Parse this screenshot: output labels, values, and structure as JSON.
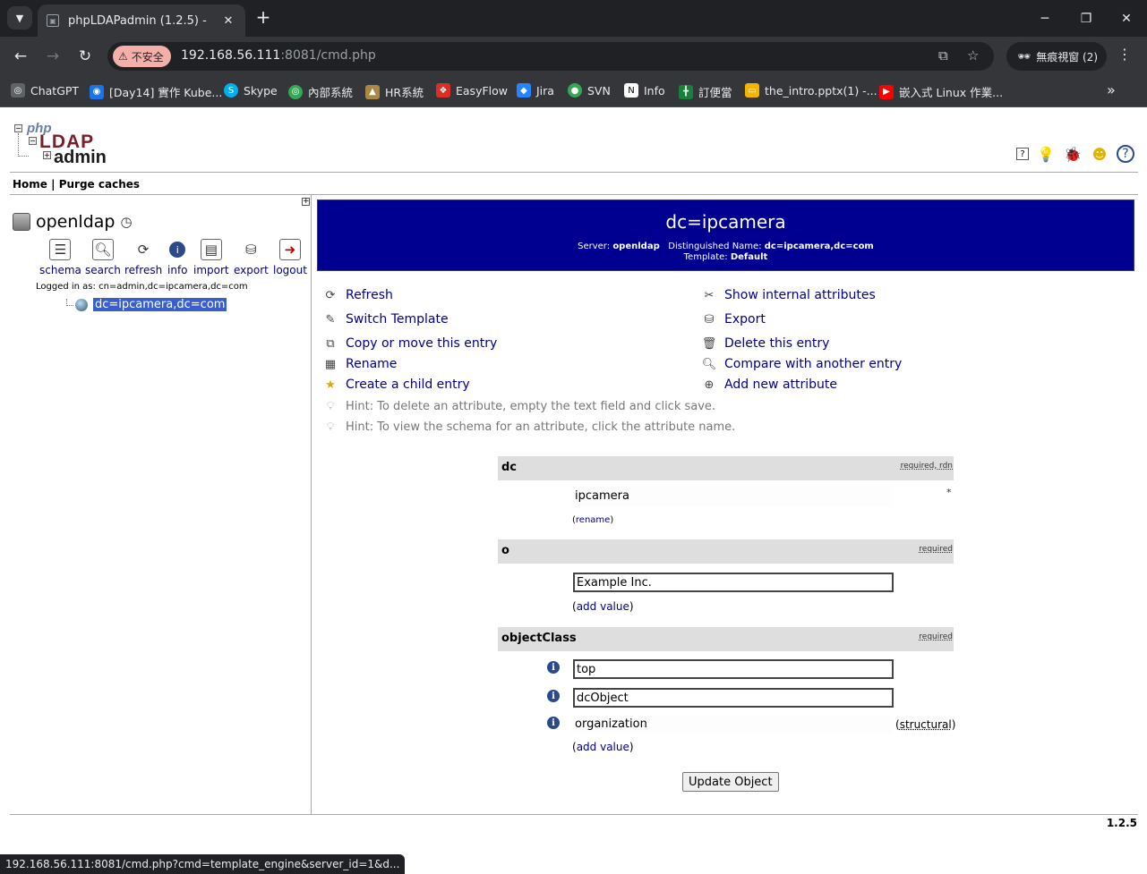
{
  "browser": {
    "tab_title": "phpLDAPadmin (1.2.5) -",
    "insecure_label": "不安全",
    "url_host": "192.168.56.111",
    "url_rest": ":8081/cmd.php",
    "incognito_label": "無痕視窗 (2)",
    "bookmarks": [
      {
        "label": "ChatGPT",
        "icon": "chatgpt-icon",
        "color": "#5f6368"
      },
      {
        "label": "[Day14] 實作 Kube...",
        "icon": "ithome-icon",
        "color": "#1a73e8"
      },
      {
        "label": "Skype",
        "icon": "skype-icon",
        "color": "#00aff0"
      },
      {
        "label": "內部系統",
        "icon": "internal-icon",
        "color": "#34a853"
      },
      {
        "label": "HR系統",
        "icon": "hr-icon",
        "color": "#aa8844"
      },
      {
        "label": "EasyFlow",
        "icon": "easyflow-icon",
        "color": "#d93025"
      },
      {
        "label": "Jira",
        "icon": "jira-icon",
        "color": "#2684ff"
      },
      {
        "label": "SVN",
        "icon": "svn-icon",
        "color": "#34a853"
      },
      {
        "label": "Info",
        "icon": "notion-icon",
        "color": "#ffffff"
      },
      {
        "label": "訂便當",
        "icon": "sheets-icon",
        "color": "#188038"
      },
      {
        "label": "the_intro.pptx(1) -...",
        "icon": "slides-icon",
        "color": "#f4b400"
      },
      {
        "label": "嵌入式 Linux 作業...",
        "icon": "youtube-icon",
        "color": "#ff0000"
      }
    ],
    "status_url": "192.168.56.111:8081/cmd.php?cmd=template_engine&server_id=1&d..."
  },
  "menu": {
    "home": "Home",
    "separator": "|",
    "purge": "Purge caches"
  },
  "server": {
    "name": "openldap",
    "tools": [
      {
        "label": "schema",
        "icon": "schema-icon"
      },
      {
        "label": "search",
        "icon": "search-icon"
      },
      {
        "label": "refresh",
        "icon": "refresh-icon"
      },
      {
        "label": "info",
        "icon": "info-icon"
      },
      {
        "label": "import",
        "icon": "import-icon"
      },
      {
        "label": "export",
        "icon": "export-icon"
      },
      {
        "label": "logout",
        "icon": "logout-icon"
      }
    ],
    "logged_in": "Logged in as: cn=admin,dc=ipcamera,dc=com",
    "tree_node": "dc=ipcamera,dc=com"
  },
  "entry": {
    "title": "dc=ipcamera",
    "server_label": "Server:",
    "server_value": "openldap",
    "dn_label": "Distinguished Name:",
    "dn_value": "dc=ipcamera,dc=com",
    "template_label": "Template:",
    "template_value": "Default"
  },
  "actions": {
    "refresh": "Refresh",
    "switch_template": "Switch Template",
    "copy_move": "Copy or move this entry",
    "rename": "Rename",
    "create_child": "Create a child entry",
    "show_internal": "Show internal attributes",
    "export": "Export",
    "delete": "Delete this entry",
    "compare": "Compare with another entry",
    "add_attribute": "Add new attribute",
    "hint1": "Hint: To delete an attribute, empty the text field and click save.",
    "hint2": "Hint: To view the schema for an attribute, click the attribute name."
  },
  "attributes": {
    "dc": {
      "name": "dc",
      "flags": "required, rdn",
      "value": "ipcamera",
      "rename": "rename",
      "asterisk": "*"
    },
    "o": {
      "name": "o",
      "flags": "required",
      "value": "Example Inc.",
      "add_value": "add value"
    },
    "objectClass": {
      "name": "objectClass",
      "flags": "required",
      "values": [
        "top",
        "dcObject"
      ],
      "structural_value": "organization",
      "structural_label": "structural",
      "add_value": "add value"
    }
  },
  "update_button": "Update Object",
  "version": "1.2.5",
  "colors": {
    "header_bg": "#000090",
    "link": "#00008b",
    "attr_header": "#dedede",
    "tree_selected": "#3a5fcd"
  }
}
